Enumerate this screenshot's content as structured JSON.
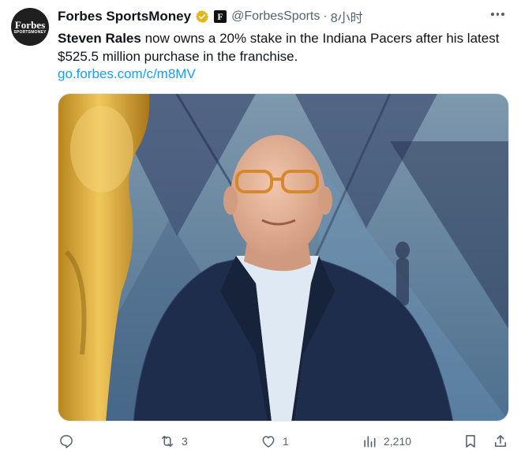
{
  "author": {
    "display_name": "Forbes SportsMoney",
    "handle": "@ForbesSports",
    "separator": "·",
    "time": "8小时",
    "avatar_text_main": "Forbes",
    "avatar_text_sub": "SPORTSMONEY",
    "affiliate_badge": "F"
  },
  "tweet": {
    "bold_name": "Steven Rales",
    "text": " now owns a 20% stake in the Indiana Pacers after his latest $525.5 million purchase in the franchise.",
    "link": "go.forbes.com/c/m8MV"
  },
  "actions": {
    "replies": "",
    "retweets": "3",
    "likes": "1",
    "views": "2,210"
  },
  "icons": [
    "more-icon",
    "verified-icon",
    "reply-icon",
    "retweet-icon",
    "like-icon",
    "views-icon",
    "bookmark-icon",
    "share-icon"
  ],
  "colors": {
    "link": "#1d9bf0",
    "verified": "#e2b719",
    "muted": "#536471"
  }
}
